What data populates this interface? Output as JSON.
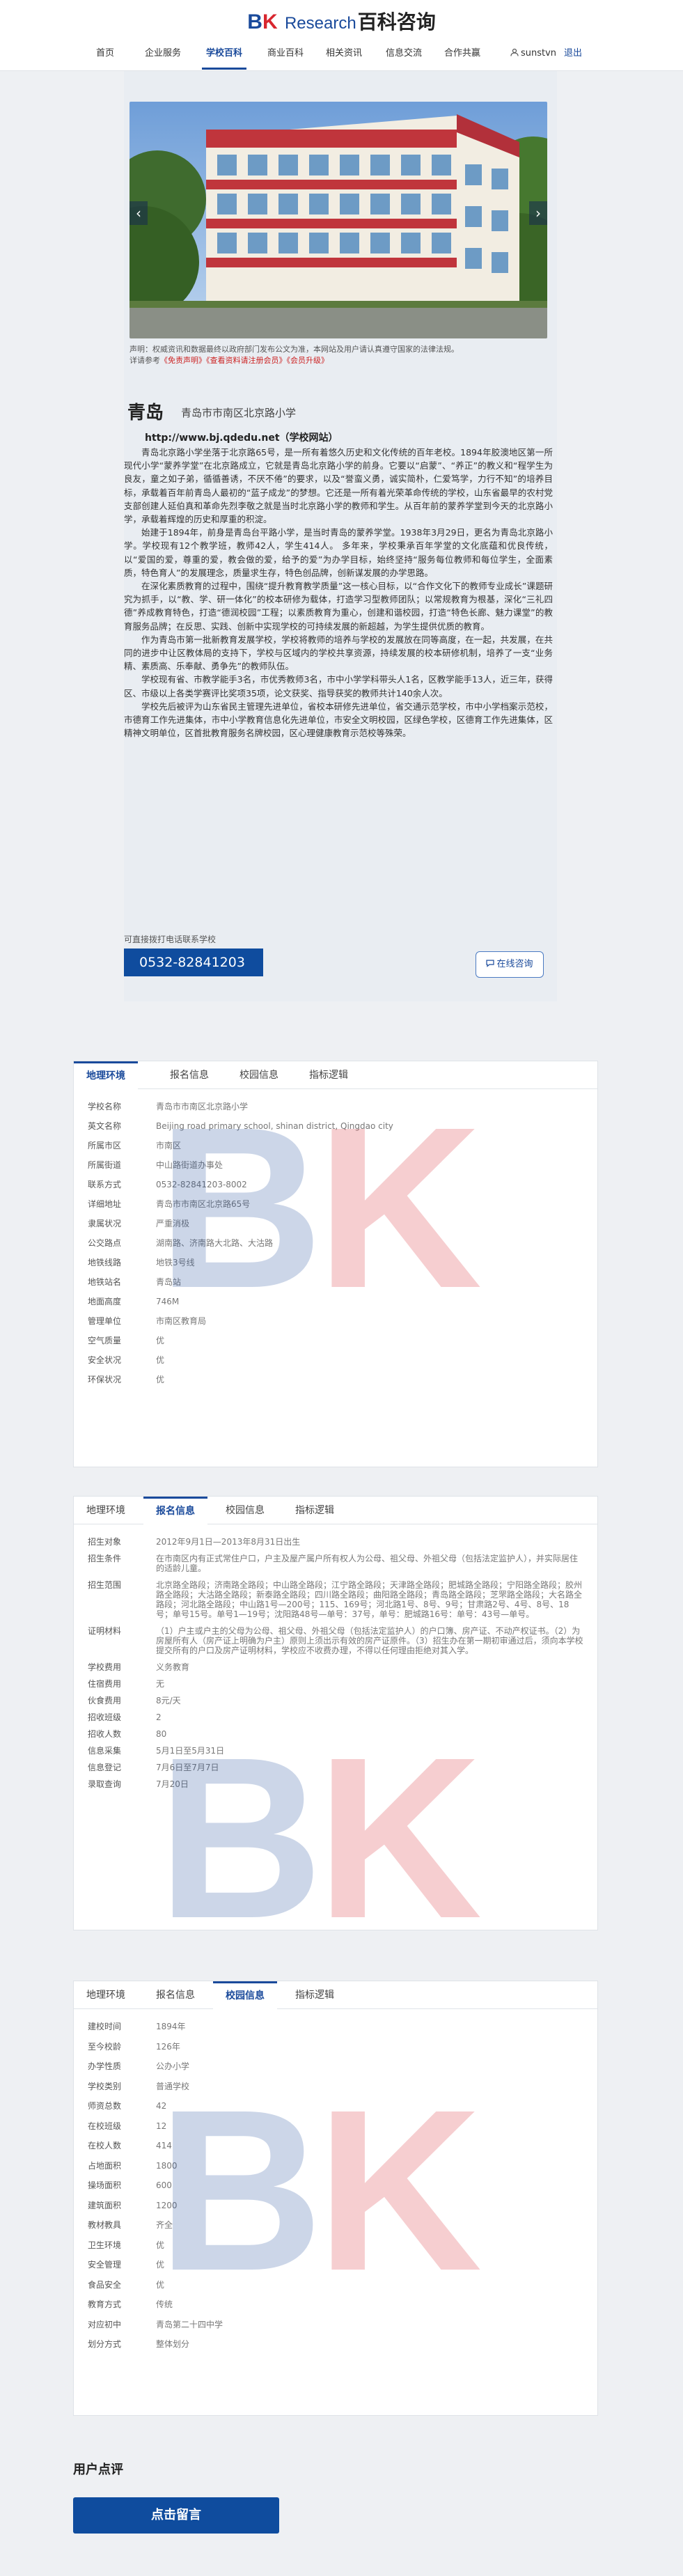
{
  "header": {
    "logo": {
      "bk_b": "B",
      "bk_k": "K",
      "research": "Research",
      "brand_cn": "百科咨询"
    },
    "nav": [
      "首页",
      "企业服务",
      "学校百科",
      "商业百科",
      "相关资讯",
      "信息交流",
      "合作共赢"
    ],
    "active_nav": "学校百科",
    "username": "sunstvn",
    "logout": "退出"
  },
  "hero": {
    "disclaimer": "声明：权威资讯和数据最终以政府部门发布公文为准，本网站及用户请认真遵守国家的法律法规。",
    "disclaimer_more_prefix": "详请参考",
    "link_disclaimer": "《免责声明》",
    "link_rules": "《查看资料请注册会员》",
    "link_upgrade": "《会员升级》"
  },
  "school": {
    "city": "青岛",
    "name": "青岛市市南区北京路小学",
    "url": "http://www.bj.qdedu.net（学校网站）",
    "paragraphs": [
      "青岛北京路小学坐落于北京路65号，是一所有着悠久历史和文化传统的百年老校。1894年胶澳地区第一所现代小学“蒙养学堂”在北京路成立，它就是青岛北京路小学的前身。它要以“启蒙”、“养正”的教义和“程学生为良友，童之如子弟，循循善诱，不厌不倦”的要求，以及“誉蛮义勇，诚实简朴，仁爱笃学，力行不知”的培养目标，承载着百年前青岛人最初的“蓝子成龙”的梦想。它还是一所有着光荣革命传统的学校，山东省最早的农村党支部创建人延伯真和革命先烈李敬之就是当时北京路小学的教师和学生。从百年前的蒙养学堂到今天的北京路小学，承载着辉煌的历史和厚重的积淀。",
      "始建于1894年，前身是青岛台平路小学，是当时青岛的蒙养学堂。1938年3月29日，更名为青岛北京路小学。学校现有12个教学班，教师42人，学生414人。 多年来，学校秉承百年学堂的文化底蕴和优良传统，以“爱国的爱，尊重的爱，教会做的爱，给予的爱”为办学目标，始终坚持“服务每位教师和每位学生，全面素质，特色育人”的发展理念，质量求生存，特色创品牌，创新谋发展的办学思路。",
      "在深化素质教育的过程中，围绕“提升教育教学质量”这一核心目标，以“合作文化下的教师专业成长”课题研究为抓手，以“教、学、研一体化”的校本研修为载体，打造学习型教师团队；以常规教育为根基，深化“三礼四德”养成教育特色，打造“德润校园”工程；以素质教育为重心，创建和谐校园，打造“特色长廊、魅力课堂”的教育服务品牌；在反思、实践、创新中实现学校的可持续发展的新超越，为学生提供优质的教育。",
      "作为青岛市第一批新教育发展学校，学校将教师的培养与学校的发展放在同等高度，在一起，共发展，在共同的进步中让区教体局的支持下，学校与区域内的学校共享资源，持续发展的校本研修机制，培养了一支“业务精、素质高、乐奉献、勇争先”的教师队伍。",
      "学校现有省、市教学能手3名，市优秀教师3名，市中小学学科带头人1名，区教学能手13人，近三年，获得区、市级以上各类学赛评比奖项35项，论文获奖、指导获奖的教师共计140余人次。",
      "学校先后被评为山东省民主管理先进单位，省校本研修先进单位，省交通示范学校，市中小学档案示范校，市德育工作先进集体，市中小学教育信息化先进单位，市安全文明校园，区绿色学校，区德育工作先进集体，区精神文明单位，区首批教育服务名牌校园，区心理健康教育示范校等殊荣。"
    ],
    "consult_label": "可直接拨打电话联系学校",
    "phone": "0532-82841203",
    "online": "在线咨询"
  },
  "tabs": [
    "地理环境",
    "报名信息",
    "校园信息",
    "指标逻辑"
  ],
  "geo": [
    {
      "k": "学校名称",
      "v": "青岛市市南区北京路小学"
    },
    {
      "k": "英文名称",
      "v": "Beijing road primary school, shinan district, Qingdao city"
    },
    {
      "k": "所属市区",
      "v": "市南区"
    },
    {
      "k": "所属街道",
      "v": "中山路街道办事处"
    },
    {
      "k": "联系方式",
      "v": "0532-82841203-8002"
    },
    {
      "k": "详细地址",
      "v": "青岛市市南区北京路65号"
    },
    {
      "k": "隶属状况",
      "v": "严重消极"
    },
    {
      "k": "公交路点",
      "v": "湖南路、济南路大北路、大沽路"
    },
    {
      "k": "地铁线路",
      "v": "地铁3号线"
    },
    {
      "k": "地铁站名",
      "v": "青岛站"
    },
    {
      "k": "地面高度",
      "v": "746M"
    },
    {
      "k": "管理单位",
      "v": "市南区教育局"
    },
    {
      "k": "空气质量",
      "v": "优"
    },
    {
      "k": "安全状况",
      "v": "优"
    },
    {
      "k": "环保状况",
      "v": "优"
    }
  ],
  "enroll": [
    {
      "k": "招生对象",
      "v": "2012年9月1日—2013年8月31日出生"
    },
    {
      "k": "招生条件",
      "v": "在市南区内有正式常住户口，户主及屋产属户所有权人为公母、祖父母、外祖父母（包括法定监护人），并实际居住的适龄儿童。"
    },
    {
      "k": "招生范围",
      "v": "北京路全路段；济南路全路段；中山路全路段；江宁路全路段；天津路全路段；肥城路全路段；宁阳路全路段；胶州路全路段；大沽路全路段；新泰路全路段；四川路全路段；曲阳路全路段；青岛路全路段；芝罘路全路段；大名路全路段；河北路全路段；中山路1号—200号；115、169号；河北路1号、8号、9号；甘肃路2号、4号、8号、18号；单号15号。单号1—19号；沈阳路48号—单号：37号，单号：肥城路16号：单号：43号—单号。"
    },
    {
      "k": "证明材料",
      "v": "（1）户主或户主的父母为公母、祖父母、外祖父母（包括法定监护人）的户口簿、房产证、不动产权证书。（2）为房屋所有人（房产证上明确为户主）原则上须出示有效的房产证原件。（3）招生办在第一期初审通过后，须向本学校提交所有的户口及房产证明材料，学校应不收费办理，不得以任何理由拒绝对其入学。"
    },
    {
      "k": "学校费用",
      "v": "义务教育"
    },
    {
      "k": "住宿费用",
      "v": "无"
    },
    {
      "k": "伙食费用",
      "v": "8元/天"
    },
    {
      "k": "招收班级",
      "v": "2"
    },
    {
      "k": "招收人数",
      "v": "80"
    },
    {
      "k": "信息采集",
      "v": "5月1日至5月31日"
    },
    {
      "k": "信息登记",
      "v": "7月6日至7月7日"
    },
    {
      "k": "录取查询",
      "v": "7月20日"
    }
  ],
  "campus": [
    {
      "k": "建校时间",
      "v": "1894年"
    },
    {
      "k": "至今校龄",
      "v": "126年"
    },
    {
      "k": "办学性质",
      "v": "公办小学"
    },
    {
      "k": "学校类别",
      "v": "普通学校"
    },
    {
      "k": "师资总数",
      "v": "42"
    },
    {
      "k": "在校班级",
      "v": "12"
    },
    {
      "k": "在校人数",
      "v": "414"
    },
    {
      "k": "占地面积",
      "v": "1800"
    },
    {
      "k": "操场面积",
      "v": "600"
    },
    {
      "k": "建筑面积",
      "v": "1200"
    },
    {
      "k": "教材教具",
      "v": "齐全"
    },
    {
      "k": "卫生环境",
      "v": "优"
    },
    {
      "k": "安全管理",
      "v": "优"
    },
    {
      "k": "食品安全",
      "v": "优"
    },
    {
      "k": "教育方式",
      "v": "传统"
    },
    {
      "k": "对应初中",
      "v": "青岛第二十四中学"
    },
    {
      "k": "划分方式",
      "v": "整体划分"
    }
  ],
  "comments": {
    "title": "用户点评",
    "button": "点击留言"
  }
}
